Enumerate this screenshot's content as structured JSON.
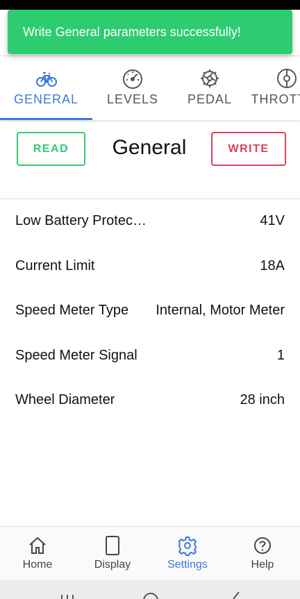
{
  "toast": {
    "message": "Write General parameters successfully!"
  },
  "tabs": [
    {
      "label": "GENERAL",
      "icon": "bicycle-icon",
      "active": true
    },
    {
      "label": "LEVELS",
      "icon": "speedometer-icon",
      "active": false
    },
    {
      "label": "PEDAL",
      "icon": "sprocket-icon",
      "active": false
    },
    {
      "label": "THROTTLE",
      "icon": "throttle-icon",
      "active": false
    }
  ],
  "actions": {
    "read_label": "READ",
    "write_label": "WRITE",
    "title": "General"
  },
  "params": [
    {
      "name": "Low Battery Protection",
      "value": "41V"
    },
    {
      "name": "Current Limit",
      "value": "18A"
    },
    {
      "name": "Speed Meter Type",
      "value": "Internal, Motor Meter"
    },
    {
      "name": "Speed Meter Signal",
      "value": "1"
    },
    {
      "name": "Wheel Diameter",
      "value": "28 inch"
    }
  ],
  "bottom_nav": [
    {
      "label": "Home",
      "icon": "home-icon",
      "active": false
    },
    {
      "label": "Display",
      "icon": "display-icon",
      "active": false
    },
    {
      "label": "Settings",
      "icon": "gear-icon",
      "active": true
    },
    {
      "label": "Help",
      "icon": "help-icon",
      "active": false
    }
  ],
  "colors": {
    "accent": "#3a7bd5",
    "success": "#2ecc71",
    "danger": "#d9415a"
  }
}
